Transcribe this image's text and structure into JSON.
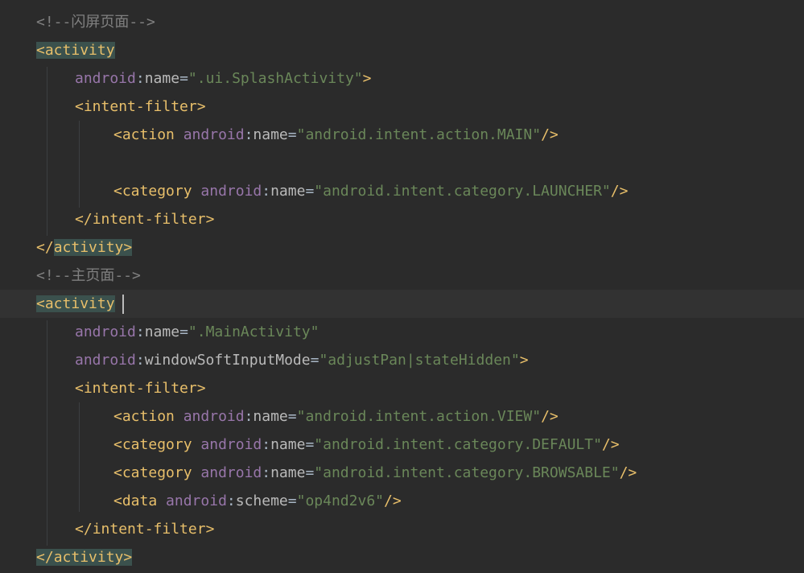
{
  "top_partial": "             ",
  "lines": {
    "l1": {
      "comment": "<!--闪屏页面-->"
    },
    "l2": {
      "open": "<",
      "tag": "activity"
    },
    "l3": {
      "ns": "android",
      "colon": ":",
      "attr": "name",
      "eq": "=",
      "value": "\".ui.SplashActivity\"",
      "end": ">"
    },
    "l4": {
      "open": "<",
      "tag": "intent-filter",
      "end": ">"
    },
    "l5": {
      "open": "<",
      "tag": "action",
      "ns": "android",
      "colon": ":",
      "attr": "name",
      "eq": "=",
      "value": "\"android.intent.action.MAIN\"",
      "end": "/>"
    },
    "l7": {
      "open": "<",
      "tag": "category",
      "ns": "android",
      "colon": ":",
      "attr": "name",
      "eq": "=",
      "value": "\"android.intent.category.LAUNCHER\"",
      "end": "/>"
    },
    "l8": {
      "open": "</",
      "tag": "intent-filter",
      "end": ">"
    },
    "l9": {
      "open": "</",
      "tag": "activity",
      "end": ">"
    },
    "l10": {
      "comment": "<!--主页面-->"
    },
    "l11": {
      "open": "<",
      "tag": "activity"
    },
    "l12": {
      "ns": "android",
      "colon": ":",
      "attr": "name",
      "eq": "=",
      "value": "\".MainActivity\""
    },
    "l13": {
      "ns": "android",
      "colon": ":",
      "attr": "windowSoftInputMode",
      "eq": "=",
      "value": "\"adjustPan|stateHidden\"",
      "end": ">"
    },
    "l14": {
      "open": "<",
      "tag": "intent-filter",
      "end": ">"
    },
    "l15": {
      "open": "<",
      "tag": "action",
      "ns": "android",
      "colon": ":",
      "attr": "name",
      "eq": "=",
      "value": "\"android.intent.action.VIEW\"",
      "end": "/>"
    },
    "l16": {
      "open": "<",
      "tag": "category",
      "ns": "android",
      "colon": ":",
      "attr": "name",
      "eq": "=",
      "value": "\"android.intent.category.DEFAULT\"",
      "end": "/>"
    },
    "l17": {
      "open": "<",
      "tag": "category",
      "ns": "android",
      "colon": ":",
      "attr": "name",
      "eq": "=",
      "value": "\"android.intent.category.BROWSABLE\"",
      "end": "/>"
    },
    "l18": {
      "open": "<",
      "tag": "data",
      "ns": "android",
      "colon": ":",
      "attr": "scheme",
      "eq": "=",
      "value": "\"op4nd2v6\"",
      "end": "/>"
    },
    "l19": {
      "open": "</",
      "tag": "intent-filter",
      "end": ">"
    },
    "l20": {
      "open": "</",
      "tag": "activity",
      "end": ">"
    }
  },
  "colors": {
    "background": "#2b2b2b",
    "current_line": "#323232",
    "tag": "#e8bf6a",
    "namespace": "#9876aa",
    "attribute": "#bababa",
    "string": "#6a8759",
    "comment": "#808080",
    "match_highlight": "#3b514d"
  }
}
